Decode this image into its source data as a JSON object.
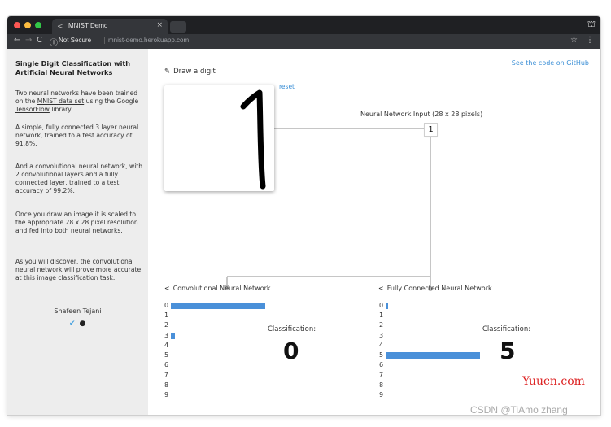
{
  "browser": {
    "tab_title": "MNIST Demo",
    "tab_close": "×",
    "security_label": "Not Secure",
    "url": "mnist-demo.herokuapp.com",
    "colors": {
      "dot_close": "#fc5753",
      "dot_min": "#fdbc40",
      "dot_max": "#33c748"
    }
  },
  "sidebar": {
    "title": "Single Digit Classification with Artificial Neural Networks",
    "p1_a": "Two neural networks have been trained on the ",
    "p1_link1": "MNIST data set",
    "p1_b": " using the Google ",
    "p1_link2": "TensorFlow",
    "p1_c": " library.",
    "p2": "A simple, fully connected 3 layer neural network, trained to a test accuracy of 91.8%.",
    "p3": "And a convolutional neural network, with 2 convolutional layers and a fully connected layer, trained to a test accuracy of 99.2%.",
    "p4": "Once you draw an image it is scaled to the appropriate 28 x 28 pixel resolution and fed into both neural networks.",
    "p5": "As you will discover, the convolutional neural network will prove more accurate at this image classification task.",
    "author": "Shafeen Tejani"
  },
  "main": {
    "github_link": "See the code on GitHub",
    "draw_label": "Draw a digit",
    "reset": "reset",
    "input_label": "Neural Network Input (28 x 28 pixels)",
    "input_preview": "1",
    "digits": [
      "0",
      "1",
      "2",
      "3",
      "4",
      "5",
      "6",
      "7",
      "8",
      "9"
    ],
    "classification_label": "Classification:",
    "cnn": {
      "title": "Convolutional Neural Network",
      "result": "0",
      "probs": [
        0.93,
        0,
        0,
        0.04,
        0,
        0,
        0,
        0,
        0,
        0
      ]
    },
    "fc": {
      "title": "Fully Connected Neural Network",
      "result": "5",
      "probs": [
        0.01,
        0,
        0,
        0,
        0,
        0.97,
        0,
        0,
        0,
        0
      ]
    },
    "bar_color": "#4a90d9"
  },
  "watermarks": {
    "site": "Yuucn.com",
    "credit": "CSDN @TiAmo zhang"
  }
}
